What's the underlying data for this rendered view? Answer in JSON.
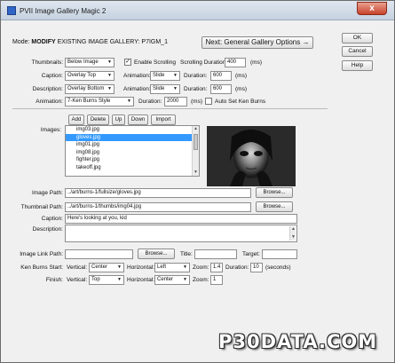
{
  "window": {
    "title": "PVII Image Gallery Magic 2",
    "close_label": "x"
  },
  "mode": {
    "label": "Mode:",
    "value": "MODIFY",
    "detail": "EXISTING IMAGE GALLERY: P7IGM_1"
  },
  "next_button": "Next: General Gallery Options →",
  "side_buttons": {
    "ok": "OK",
    "cancel": "Cancel",
    "help": "Help"
  },
  "general": {
    "thumbnails_label": "Thumbnails:",
    "thumbnails_value": "Below Image",
    "enable_scrolling_label": "Enable Scrolling",
    "enable_scrolling_checked": true,
    "scrolling_duration_label": "Scrolling Duration:",
    "scrolling_duration_value": "400",
    "ms": "(ms)",
    "caption_label": "Caption:",
    "caption_value": "Overlay Top",
    "caption_animation_label": "Animation:",
    "caption_animation_value": "Slide",
    "caption_duration_label": "Duration:",
    "caption_duration_value": "600",
    "description_label": "Description:",
    "description_value": "Overlay Bottom",
    "description_animation_label": "Animation:",
    "description_animation_value": "Slide",
    "description_duration_label": "Duration:",
    "description_duration_value": "600",
    "animation_label": "Animation:",
    "animation_value": "7-Ken Burns Style",
    "animation_duration_label": "Duration:",
    "animation_duration_value": "2000",
    "auto_set_label": "Auto Set Ken Burns",
    "auto_set_checked": false
  },
  "list_buttons": {
    "add": "Add",
    "delete": "Delete",
    "up": "Up",
    "down": "Down",
    "import": "Import"
  },
  "images": {
    "label": "Images:",
    "items": [
      "img03.jpg",
      "gloves.jpg",
      "img01.jpg",
      "img08.jpg",
      "fighter.jpg",
      "takeoff.jpg"
    ],
    "selected_index": 1
  },
  "image_fields": {
    "image_path_label": "Image Path:",
    "image_path_value": "../art/burns-1/fullsize/gloves.jpg",
    "thumbnail_path_label": "Thumbnail Path:",
    "thumbnail_path_value": "../art/burns-1/thumbs/img04.jpg",
    "browse": "Browse...",
    "caption_label": "Caption:",
    "caption_value": "Here's looking at you, kid",
    "description_label": "Description:",
    "description_value": "",
    "image_link_label": "Image Link Path:",
    "image_link_value": "",
    "title_label": "Title:",
    "title_value": "",
    "target_label": "Target:",
    "target_value": ""
  },
  "ken_burns": {
    "start_label": "Ken Burns Start:",
    "finish_label": "Finish:",
    "vertical_label": "Vertical:",
    "horizontal_label": "Horizontal:",
    "zoom_label": "Zoom:",
    "duration_label": "Duration:",
    "seconds": "(seconds)",
    "start_vertical": "Center",
    "start_horizontal": "Left",
    "start_zoom": "1.4",
    "start_duration": "10",
    "finish_vertical": "Top",
    "finish_horizontal": "Center",
    "finish_zoom": "1"
  },
  "watermark": "P30DATA.COM"
}
